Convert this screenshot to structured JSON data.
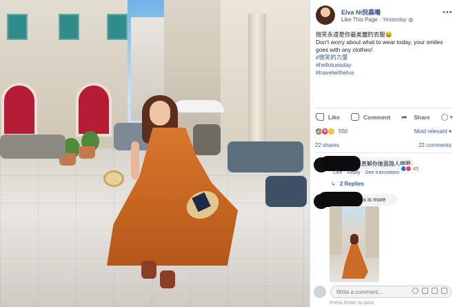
{
  "post": {
    "author": "Elva Ni倪晨曦",
    "like_page": "Like This Page",
    "time": "Yesterday",
    "caption_zh": "微笑永遠是你最美麗的衣服😄",
    "caption_en": "Don't worry about what to wear today, your smiles goes with any clothes!",
    "hashtags": [
      "#微笑的力量",
      "#hellotuesday",
      "#travelwithelva"
    ]
  },
  "actions": {
    "like": "Like",
    "comment": "Comment",
    "share": "Share"
  },
  "stats": {
    "reaction_count": "550",
    "sort": "Most relevant",
    "shares": "22 shares",
    "comments": "22 comments"
  },
  "comments": [
    {
      "text": "甚解你後面路人傻眼...",
      "like_label": "Like",
      "reply_label": "Reply",
      "see_translation": "See translation",
      "reaction_count": "45",
      "replies": "2 Replies"
    },
    {
      "text": "Less is more"
    }
  ],
  "composer": {
    "placeholder": "Write a comment...",
    "hint": "Press Enter to post."
  },
  "colors": {
    "link": "#385898",
    "like": "#1877f2",
    "love": "#f33e58",
    "haha": "#f7b928",
    "dress": "#cc6b26"
  }
}
